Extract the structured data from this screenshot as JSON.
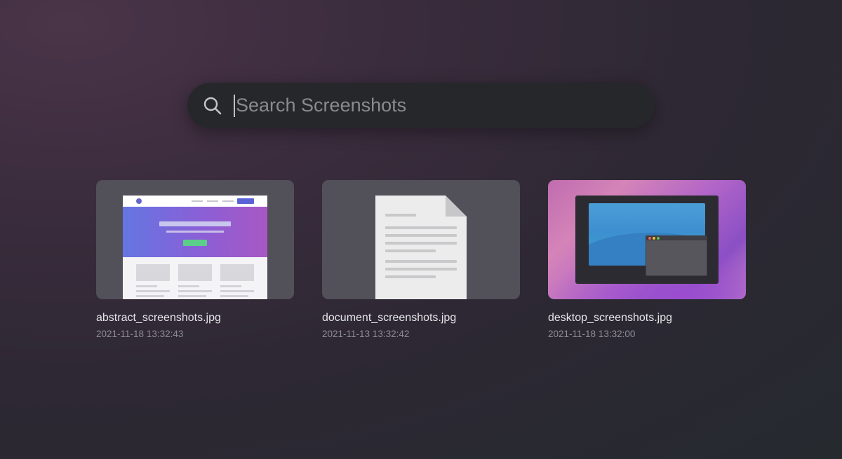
{
  "search": {
    "placeholder": "Search Screenshots",
    "value": ""
  },
  "results": [
    {
      "file_name": "abstract_screenshots.jpg",
      "timestamp": "2021-11-18 13:32:43",
      "preview": "website-mockup"
    },
    {
      "file_name": "document_screenshots.jpg",
      "timestamp": "2021-11-13 13:32:42",
      "preview": "document-page"
    },
    {
      "file_name": "desktop_screenshots.jpg",
      "timestamp": "2021-11-18 13:32:00",
      "preview": "desktop-wallpaper"
    }
  ],
  "colors": {
    "background": "#2d2833",
    "search_bar": "#26272b",
    "card": "#525058",
    "filename_text": "#e4e4e8",
    "timestamp_text": "#8e8c94"
  },
  "icons": {
    "search": "magnifying-glass-icon"
  }
}
